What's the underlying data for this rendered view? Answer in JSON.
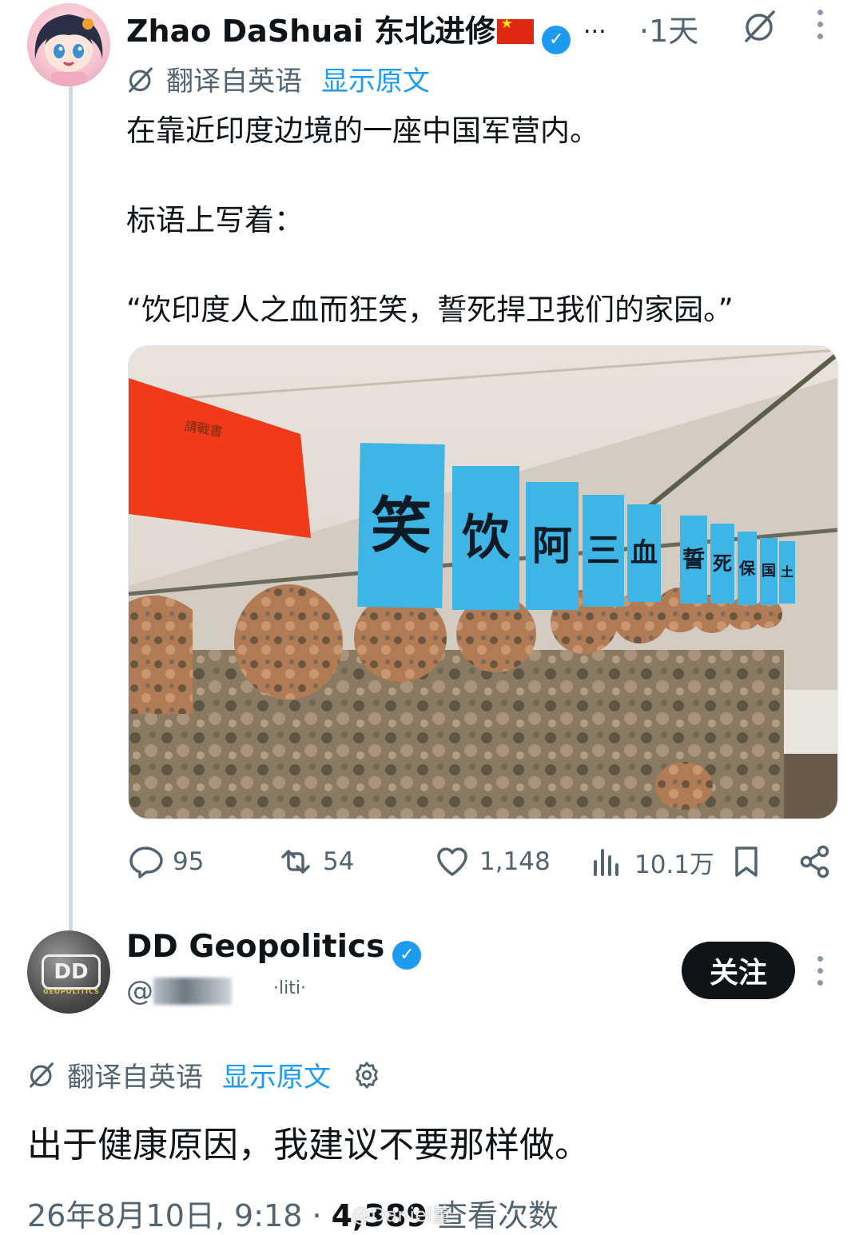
{
  "tweet1": {
    "display_name": "Zhao DaShuai 东北进修",
    "time": "·1天",
    "translation_note": "翻译自英语",
    "show_original": "显示原文",
    "body": {
      "line1": "在靠近印度边境的一座中国军营内。",
      "line2": "标语上写着：",
      "line3": "“饮印度人之血而狂笑，誓死捍卫我们的家园。”"
    },
    "media": {
      "banner_chars": [
        "笑",
        "饮",
        "阿",
        "三",
        "血",
        "誓",
        "死",
        "保",
        "国",
        "土"
      ],
      "red_sign_text": "請戰書"
    },
    "stats": {
      "replies": "95",
      "reposts": "54",
      "likes": "1,148",
      "views": "10.1万"
    }
  },
  "tweet2": {
    "display_name": "DD Geopolitics",
    "avatar_text": "DD",
    "avatar_subtext": "GEOPOLITICS",
    "handle_prefix": "@",
    "handle_tail": "·liti·",
    "follow_label": "关注",
    "translation_note": "翻译自英语",
    "show_original": "显示原文",
    "body": "出于健康原因，我建议不要那样做。",
    "date": "26年8月10日, 9:18 ·",
    "view_count": "4,389",
    "views_label": "查看次数",
    "watermark": "@Daniel董"
  },
  "colors": {
    "accent": "#1d9bf0",
    "text": "#0f1419",
    "secondary": "#536471",
    "banner_blue": "#3fb5e6",
    "sign_red": "#f03a1a"
  }
}
